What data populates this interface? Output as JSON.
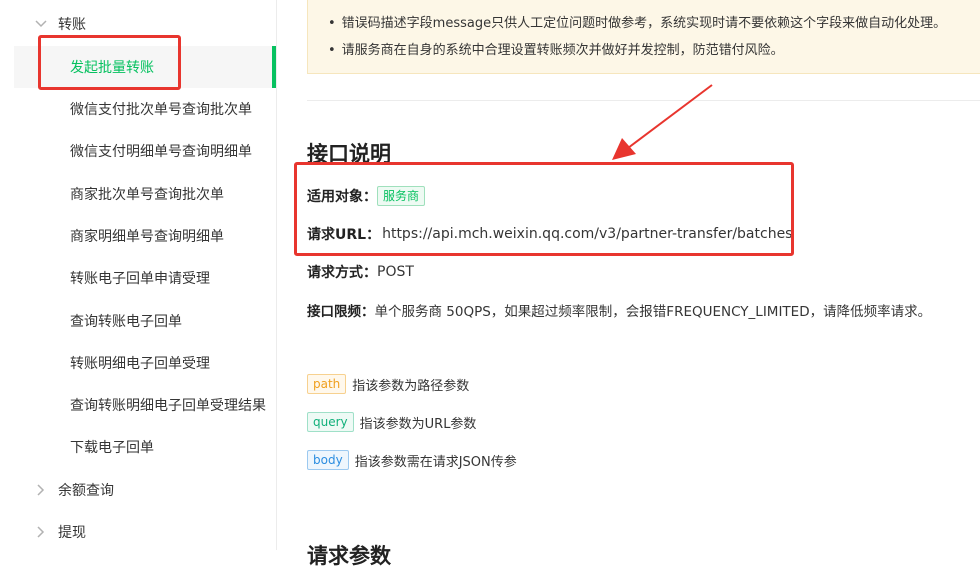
{
  "sidebar": {
    "group_transfer": "转账",
    "items": [
      {
        "label": "发起批量转账",
        "active": true
      },
      {
        "label": "微信支付批次单号查询批次单"
      },
      {
        "label": "微信支付明细单号查询明细单"
      },
      {
        "label": "商家批次单号查询批次单"
      },
      {
        "label": "商家明细单号查询明细单"
      },
      {
        "label": "转账电子回单申请受理"
      },
      {
        "label": "查询转账电子回单"
      },
      {
        "label": "转账明细电子回单受理"
      },
      {
        "label": "查询转账明细电子回单受理结果"
      },
      {
        "label": "下载电子回单"
      }
    ],
    "group_balance": "余额查询",
    "group_withdraw": "提现"
  },
  "notice": {
    "line1": "错误码描述字段message只供人工定位问题时做参考，系统实现时请不要依赖这个字段来做自动化处理。",
    "line2": "请服务商在自身的系统中合理设置转账频次并做好并发控制，防范错付风险。"
  },
  "api": {
    "title": "接口说明",
    "target_key": "适用对象：",
    "target_value": "服务商",
    "url_key": "请求URL：",
    "url_value": "https://api.mch.weixin.qq.com/v3/partner-transfer/batches",
    "method_key": "请求方式：",
    "method_value": "POST",
    "limit_key": "接口限频：",
    "limit_value": "单个服务商 50QPS，如果超过频率限制，会报错FREQUENCY_LIMITED，请降低频率请求。"
  },
  "legend": [
    {
      "tag": "path",
      "desc": "指该参数为路径参数"
    },
    {
      "tag": "query",
      "desc": "指该参数为URL参数"
    },
    {
      "tag": "body",
      "desc": "指该参数需在请求JSON传参"
    }
  ],
  "next_section_title": "请求参数",
  "colors": {
    "accent": "#07c160",
    "annotation": "#e8352e"
  }
}
